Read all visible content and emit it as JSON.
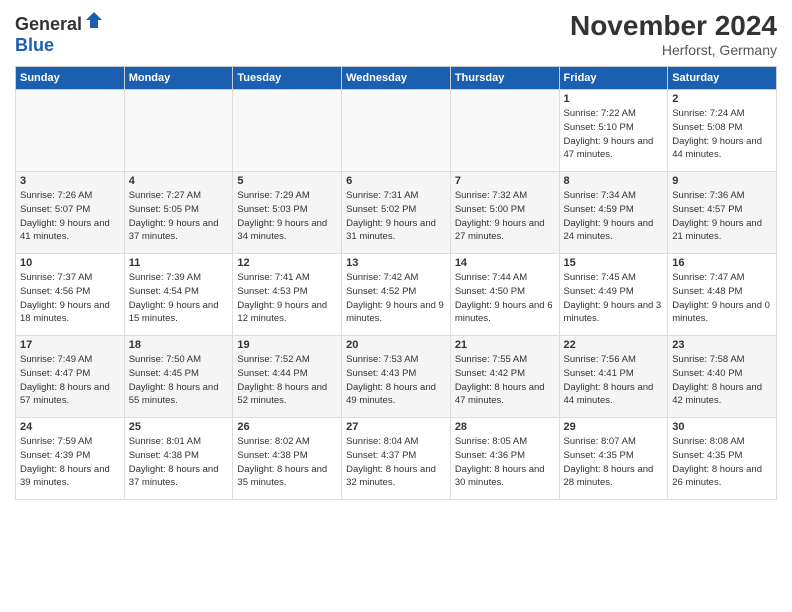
{
  "header": {
    "logo_general": "General",
    "logo_blue": "Blue",
    "title": "November 2024",
    "location": "Herforst, Germany"
  },
  "weekdays": [
    "Sunday",
    "Monday",
    "Tuesday",
    "Wednesday",
    "Thursday",
    "Friday",
    "Saturday"
  ],
  "weeks": [
    [
      {
        "day": "",
        "info": ""
      },
      {
        "day": "",
        "info": ""
      },
      {
        "day": "",
        "info": ""
      },
      {
        "day": "",
        "info": ""
      },
      {
        "day": "",
        "info": ""
      },
      {
        "day": "1",
        "info": "Sunrise: 7:22 AM\nSunset: 5:10 PM\nDaylight: 9 hours and 47 minutes."
      },
      {
        "day": "2",
        "info": "Sunrise: 7:24 AM\nSunset: 5:08 PM\nDaylight: 9 hours and 44 minutes."
      }
    ],
    [
      {
        "day": "3",
        "info": "Sunrise: 7:26 AM\nSunset: 5:07 PM\nDaylight: 9 hours and 41 minutes."
      },
      {
        "day": "4",
        "info": "Sunrise: 7:27 AM\nSunset: 5:05 PM\nDaylight: 9 hours and 37 minutes."
      },
      {
        "day": "5",
        "info": "Sunrise: 7:29 AM\nSunset: 5:03 PM\nDaylight: 9 hours and 34 minutes."
      },
      {
        "day": "6",
        "info": "Sunrise: 7:31 AM\nSunset: 5:02 PM\nDaylight: 9 hours and 31 minutes."
      },
      {
        "day": "7",
        "info": "Sunrise: 7:32 AM\nSunset: 5:00 PM\nDaylight: 9 hours and 27 minutes."
      },
      {
        "day": "8",
        "info": "Sunrise: 7:34 AM\nSunset: 4:59 PM\nDaylight: 9 hours and 24 minutes."
      },
      {
        "day": "9",
        "info": "Sunrise: 7:36 AM\nSunset: 4:57 PM\nDaylight: 9 hours and 21 minutes."
      }
    ],
    [
      {
        "day": "10",
        "info": "Sunrise: 7:37 AM\nSunset: 4:56 PM\nDaylight: 9 hours and 18 minutes."
      },
      {
        "day": "11",
        "info": "Sunrise: 7:39 AM\nSunset: 4:54 PM\nDaylight: 9 hours and 15 minutes."
      },
      {
        "day": "12",
        "info": "Sunrise: 7:41 AM\nSunset: 4:53 PM\nDaylight: 9 hours and 12 minutes."
      },
      {
        "day": "13",
        "info": "Sunrise: 7:42 AM\nSunset: 4:52 PM\nDaylight: 9 hours and 9 minutes."
      },
      {
        "day": "14",
        "info": "Sunrise: 7:44 AM\nSunset: 4:50 PM\nDaylight: 9 hours and 6 minutes."
      },
      {
        "day": "15",
        "info": "Sunrise: 7:45 AM\nSunset: 4:49 PM\nDaylight: 9 hours and 3 minutes."
      },
      {
        "day": "16",
        "info": "Sunrise: 7:47 AM\nSunset: 4:48 PM\nDaylight: 9 hours and 0 minutes."
      }
    ],
    [
      {
        "day": "17",
        "info": "Sunrise: 7:49 AM\nSunset: 4:47 PM\nDaylight: 8 hours and 57 minutes."
      },
      {
        "day": "18",
        "info": "Sunrise: 7:50 AM\nSunset: 4:45 PM\nDaylight: 8 hours and 55 minutes."
      },
      {
        "day": "19",
        "info": "Sunrise: 7:52 AM\nSunset: 4:44 PM\nDaylight: 8 hours and 52 minutes."
      },
      {
        "day": "20",
        "info": "Sunrise: 7:53 AM\nSunset: 4:43 PM\nDaylight: 8 hours and 49 minutes."
      },
      {
        "day": "21",
        "info": "Sunrise: 7:55 AM\nSunset: 4:42 PM\nDaylight: 8 hours and 47 minutes."
      },
      {
        "day": "22",
        "info": "Sunrise: 7:56 AM\nSunset: 4:41 PM\nDaylight: 8 hours and 44 minutes."
      },
      {
        "day": "23",
        "info": "Sunrise: 7:58 AM\nSunset: 4:40 PM\nDaylight: 8 hours and 42 minutes."
      }
    ],
    [
      {
        "day": "24",
        "info": "Sunrise: 7:59 AM\nSunset: 4:39 PM\nDaylight: 8 hours and 39 minutes."
      },
      {
        "day": "25",
        "info": "Sunrise: 8:01 AM\nSunset: 4:38 PM\nDaylight: 8 hours and 37 minutes."
      },
      {
        "day": "26",
        "info": "Sunrise: 8:02 AM\nSunset: 4:38 PM\nDaylight: 8 hours and 35 minutes."
      },
      {
        "day": "27",
        "info": "Sunrise: 8:04 AM\nSunset: 4:37 PM\nDaylight: 8 hours and 32 minutes."
      },
      {
        "day": "28",
        "info": "Sunrise: 8:05 AM\nSunset: 4:36 PM\nDaylight: 8 hours and 30 minutes."
      },
      {
        "day": "29",
        "info": "Sunrise: 8:07 AM\nSunset: 4:35 PM\nDaylight: 8 hours and 28 minutes."
      },
      {
        "day": "30",
        "info": "Sunrise: 8:08 AM\nSunset: 4:35 PM\nDaylight: 8 hours and 26 minutes."
      }
    ]
  ]
}
